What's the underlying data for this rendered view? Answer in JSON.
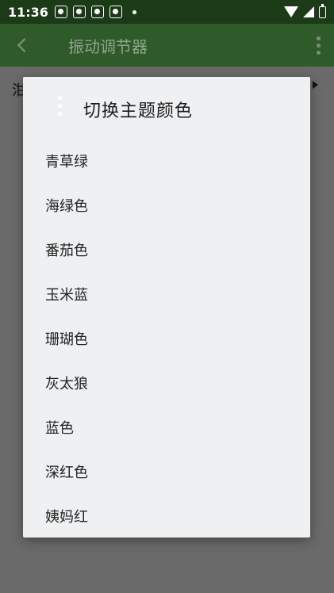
{
  "status_bar": {
    "time": "11:36",
    "notification_icons": [
      "paw-icon",
      "paw-icon",
      "paw-icon",
      "paw-icon"
    ]
  },
  "app_bar": {
    "title": "振动调节器",
    "background": "#2f5a2a"
  },
  "content": {
    "partial_text": "泔"
  },
  "dialog": {
    "title": "切换主题颜色",
    "options": [
      "青草绿",
      "海绿色",
      "番茄色",
      "玉米蓝",
      "珊瑚色",
      "灰太狼",
      "蓝色",
      "深红色",
      "姨妈红"
    ]
  }
}
